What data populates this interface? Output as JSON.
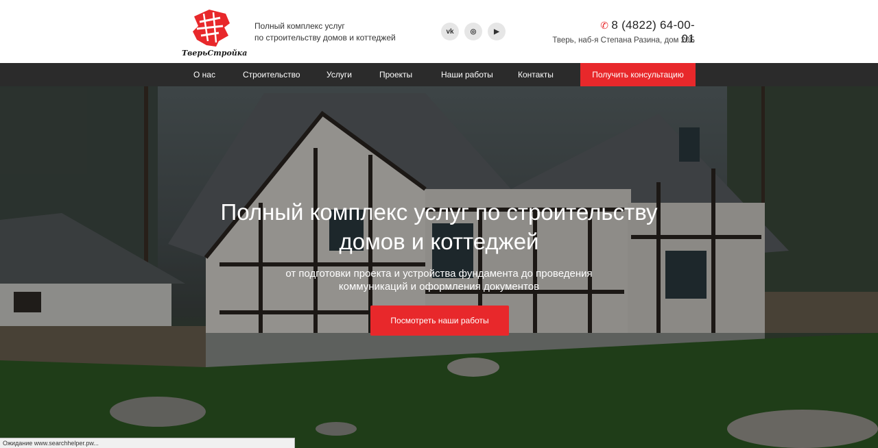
{
  "header": {
    "logo_text": "ТверьСтройка",
    "tagline_line1": "Полный комплекс услуг",
    "tagline_line2": "по строительству домов и коттеджей",
    "socials": [
      {
        "label": "vk",
        "icon": "vk-icon"
      },
      {
        "label": "◎",
        "icon": "instagram-icon"
      },
      {
        "label": "▶",
        "icon": "youtube-icon"
      }
    ],
    "phone": "8 (4822) 64-00-01",
    "address": "Тверь, наб-я Степана Разина, дом 20Б"
  },
  "nav": {
    "items": [
      "О нас",
      "Строительство",
      "Услуги",
      "Проекты",
      "Наши работы",
      "Контакты"
    ],
    "cta": "Получить консультацию"
  },
  "hero": {
    "title_line1": "Полный комплекс услуг по строительству",
    "title_line2": "домов и коттеджей",
    "subtitle_line1": "от подготовки проекта и устройства фундамента до проведения",
    "subtitle_line2": "коммуникаций и оформления документов",
    "button": "Посмотреть наши работы"
  },
  "status": {
    "text": "Ожидание www.searchhelper.pw..."
  },
  "colors": {
    "accent": "#e8282b",
    "nav_bg": "#2b2b2b"
  }
}
